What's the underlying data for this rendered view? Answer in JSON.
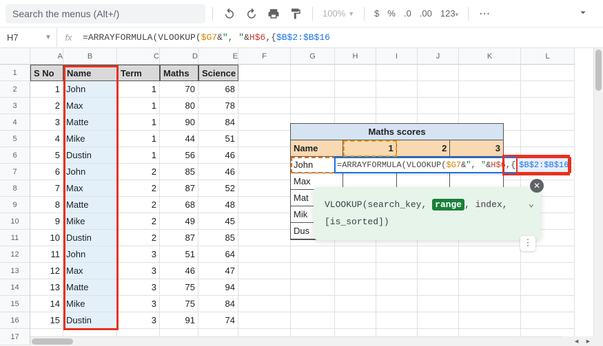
{
  "toolbar": {
    "search_placeholder": "Search the menus (Alt+/)",
    "zoom": "100%",
    "dollar": "$",
    "percent": "%",
    "dec_dec": ".0",
    "inc_dec": ".00",
    "num_fmt": "123"
  },
  "fbar": {
    "cell": "H7",
    "fx": "fx",
    "eq": "=",
    "fn1": "ARRAYFORMULA",
    "op1": "(",
    "fn2": "VLOOKUP",
    "op2": "(",
    "ref1": "$G7",
    "amp1": "&",
    "str1": "\", \"",
    "amp2": "&",
    "ref2": "H$6",
    "comma": ",",
    "brace": "{",
    "ref3": "$B$2:$B$16"
  },
  "cols": [
    "A",
    "B",
    "C",
    "D",
    "E",
    "F",
    "G",
    "H",
    "I",
    "J",
    "K",
    "L"
  ],
  "headers": {
    "a": "S No",
    "b": "Name",
    "c": "Term",
    "d": "Maths",
    "e": "Science"
  },
  "rows": [
    {
      "n": 1,
      "name": "John",
      "term": 1,
      "m": 70,
      "s": 68
    },
    {
      "n": 2,
      "name": "Max",
      "term": 1,
      "m": 80,
      "s": 78
    },
    {
      "n": 3,
      "name": "Matte",
      "term": 1,
      "m": 90,
      "s": 84
    },
    {
      "n": 4,
      "name": "Mike",
      "term": 1,
      "m": 44,
      "s": 51
    },
    {
      "n": 5,
      "name": "Dustin",
      "term": 1,
      "m": 56,
      "s": 46
    },
    {
      "n": 6,
      "name": "John",
      "term": 2,
      "m": 85,
      "s": 46
    },
    {
      "n": 7,
      "name": "Max",
      "term": 2,
      "m": 87,
      "s": 52
    },
    {
      "n": 8,
      "name": "Matte",
      "term": 2,
      "m": 68,
      "s": 48
    },
    {
      "n": 9,
      "name": "Mike",
      "term": 2,
      "m": 49,
      "s": 45
    },
    {
      "n": 10,
      "name": "Dustin",
      "term": 2,
      "m": 87,
      "s": 85
    },
    {
      "n": 11,
      "name": "John",
      "term": 3,
      "m": 51,
      "s": 64
    },
    {
      "n": 12,
      "name": "Max",
      "term": 3,
      "m": 46,
      "s": 47
    },
    {
      "n": 13,
      "name": "Matte",
      "term": 3,
      "m": 75,
      "s": 94
    },
    {
      "n": 14,
      "name": "Mike",
      "term": 3,
      "m": 75,
      "s": 84
    },
    {
      "n": 15,
      "name": "Dustin",
      "term": 3,
      "m": 91,
      "s": 74
    }
  ],
  "rt": {
    "title": "Maths scores",
    "name_h": "Name",
    "c1": "1",
    "c2": "2",
    "c3": "3",
    "names": [
      "John",
      "Max",
      "Mat",
      "Mik",
      "Dus"
    ]
  },
  "ovr": {
    "pre_eq": "=",
    "fn": "ARRAYFORMULA",
    "op1": "(",
    "fn2": "VLOOKUP",
    "op2": "(",
    "ref1": "$G7",
    "amp1": "&",
    "str1": "\", \"",
    "amp2": "&",
    "ref2": "H$6",
    "comma": ",",
    "brace": "{",
    "ref3": "$B$2:$B$16"
  },
  "hint": {
    "fn": "VLOOKUP(",
    "p1": "search_key",
    "sep": ", ",
    "p2": "range",
    "p3": "index",
    "p4": "[is_sorted]",
    "close": ")"
  }
}
